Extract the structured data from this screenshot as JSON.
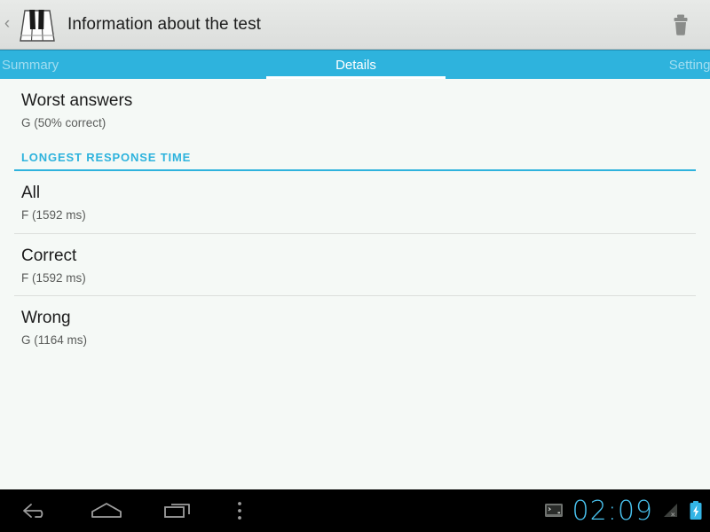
{
  "action_bar": {
    "back_label": "‹",
    "app_icon": "piano-keyboard-icon",
    "title": "Information about the test",
    "delete_icon": "trash-icon"
  },
  "tabs": [
    {
      "label": "Summary",
      "active": false
    },
    {
      "label": "Details",
      "active": true
    },
    {
      "label": "Settings",
      "active": false
    }
  ],
  "content": {
    "worst_answers": {
      "title": "Worst answers",
      "subtitle": "G (50% correct)"
    },
    "section_header": "LONGEST RESPONSE TIME",
    "rows": [
      {
        "title": "All",
        "subtitle": "F (1592 ms)"
      },
      {
        "title": "Correct",
        "subtitle": "F (1592 ms)"
      },
      {
        "title": "Wrong",
        "subtitle": "G (1164 ms)"
      }
    ]
  },
  "nav_bar": {
    "back_icon": "back-arrow-icon",
    "home_icon": "home-icon",
    "recents_icon": "recent-apps-icon",
    "overflow_icon": "overflow-menu-icon",
    "screencast_icon": "monitor-icon",
    "signal_icon": "no-signal-icon",
    "battery_icon": "battery-charging-icon",
    "clock": "02:09"
  },
  "colors": {
    "accent": "#2eb3dd",
    "action_bar": "#e2e4e2",
    "content_bg": "#f5f9f6",
    "clock": "#49c3f0",
    "battery": "#33b5e5"
  }
}
